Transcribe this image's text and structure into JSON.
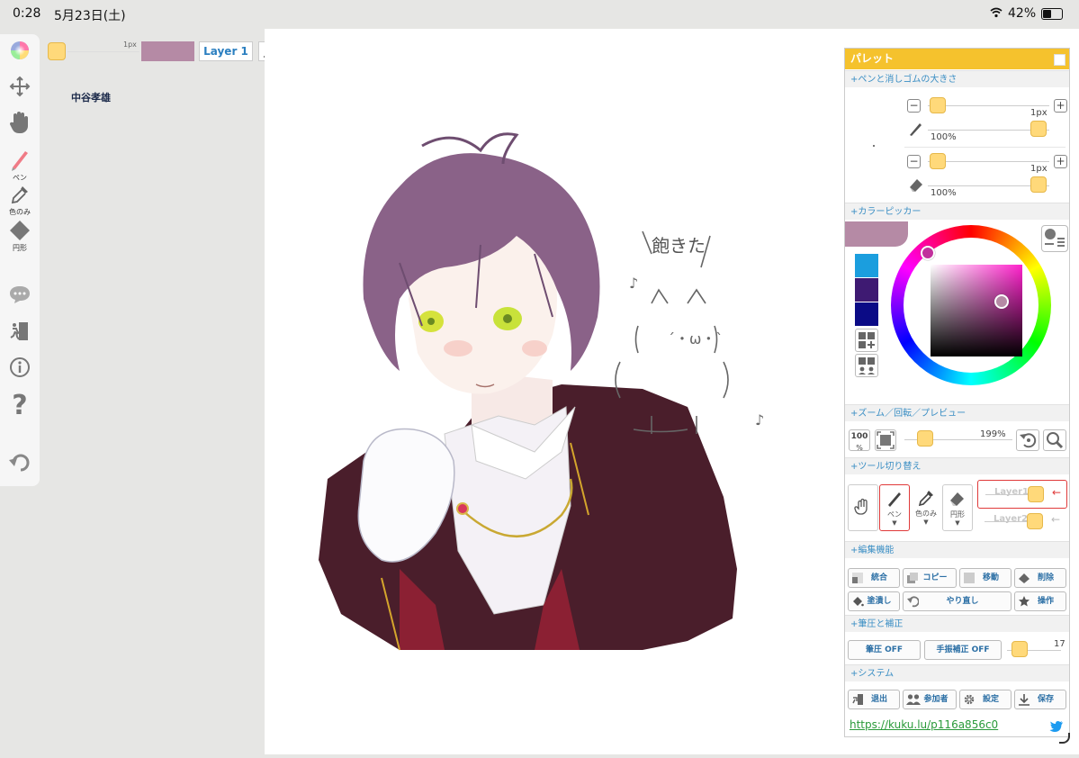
{
  "status_bar": {
    "time": "0:28",
    "date": "5月23日(土)",
    "battery": "42%"
  },
  "left_toolbar": {
    "pen_label": "ペン",
    "eyedropper_label": "色のみ",
    "shape_label": "円形"
  },
  "top_bar": {
    "brush_size": "1px",
    "current_color": "#b58aa5",
    "layer_label": "Layer 1"
  },
  "canvas": {
    "author_name": "中谷孝雄"
  },
  "palette": {
    "title": "パレット",
    "pen_eraser_section": "+ペンと消しゴムの大きさ",
    "pen": {
      "size": "1px",
      "opacity": "100%"
    },
    "eraser": {
      "size": "1px",
      "opacity": "100%"
    },
    "color_picker_section": "+カラーピッカー",
    "current_color": "#b58aa5",
    "swatches": [
      "#1b9ede",
      "#3e1a72",
      "#0b0b86"
    ],
    "zoom_section": "+ズーム／回転／プレビュー",
    "zoom_reset_label": "100",
    "zoom_reset_unit": "%",
    "zoom_value": "199%",
    "tool_switch_section": "+ツール切り替え",
    "tools": {
      "pen": "ペン",
      "eyedropper": "色のみ",
      "shape": "円形"
    },
    "layers": [
      {
        "name": "Layer1",
        "active": true
      },
      {
        "name": "Layer2",
        "active": false
      }
    ],
    "edit_section": "+編集機能",
    "edit_buttons": {
      "merge": "統合",
      "copy": "コピー",
      "move": "移動",
      "delete": "削除",
      "fill": "塗潰し",
      "redo": "やり直し",
      "action": "操作"
    },
    "pressure_section": "+筆圧と補正",
    "pressure_button": "筆圧 OFF",
    "stabilizer_button": "手振補正 OFF",
    "stabilizer_value": "17",
    "system_section": "+システム",
    "system_buttons": {
      "exit": "退出",
      "participants": "参加者",
      "settings": "設定",
      "save": "保存"
    },
    "url": "https://kuku.lu/p116a856c0"
  }
}
